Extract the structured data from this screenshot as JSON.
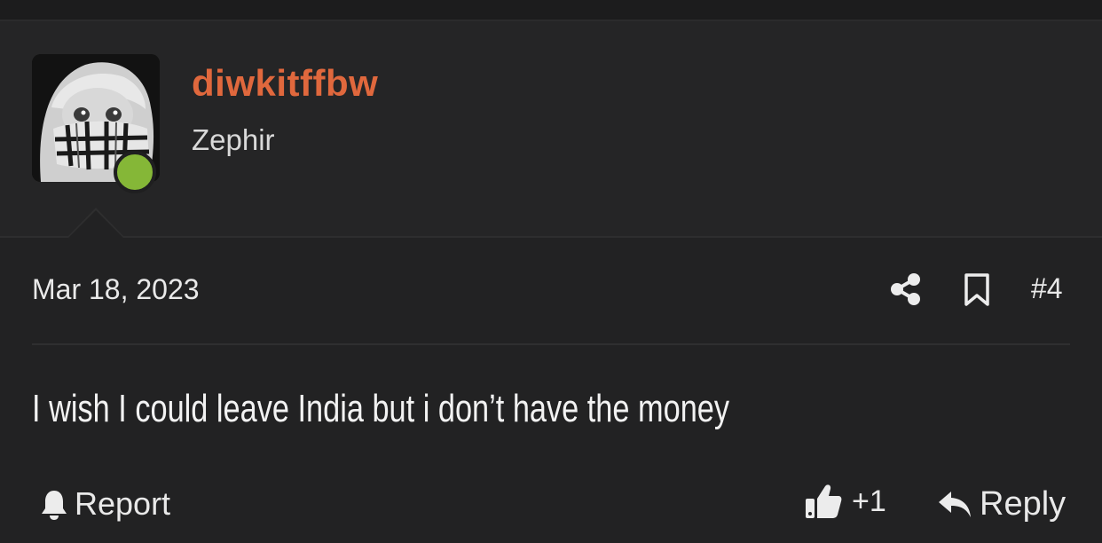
{
  "post": {
    "author": {
      "username": "diwkitffbw",
      "title": "Zephir",
      "online": true,
      "avatar_icon": "anime-avatar-with-scarf"
    },
    "date": "Mar 18, 2023",
    "number": "#4",
    "message": "I wish I could leave India but i don’t have the money",
    "actions": {
      "report_label": "Report",
      "like_count": "+1",
      "reply_label": "Reply"
    }
  },
  "colors": {
    "background": "#222223",
    "username": "#e0683d",
    "online_dot": "#85b737",
    "text": "#e9e9e9"
  }
}
